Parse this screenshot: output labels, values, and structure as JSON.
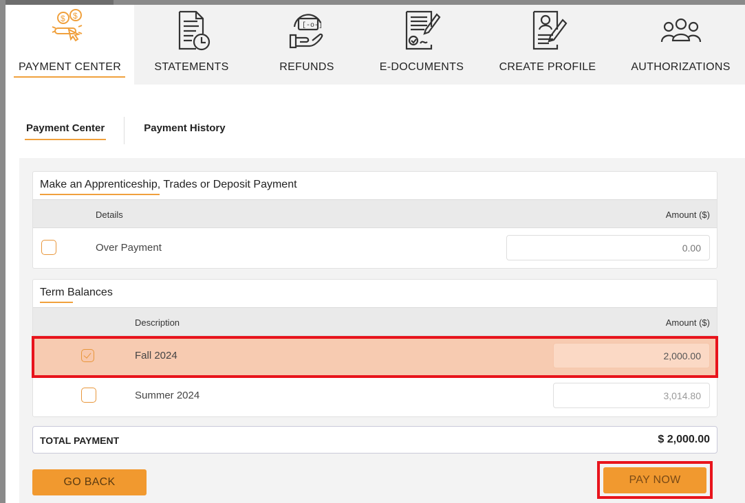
{
  "nav": {
    "items": [
      {
        "label": "PAYMENT CENTER",
        "icon": "payment-hand-icon",
        "active": true
      },
      {
        "label": "STATEMENTS",
        "icon": "statement-clock-icon",
        "active": false
      },
      {
        "label": "REFUNDS",
        "icon": "refund-hand-icon",
        "active": false
      },
      {
        "label": "E-DOCUMENTS",
        "icon": "document-sign-icon",
        "active": false
      },
      {
        "label": "CREATE PROFILE",
        "icon": "profile-edit-icon",
        "active": false
      },
      {
        "label": "AUTHORIZATIONS",
        "icon": "group-users-icon",
        "active": false
      }
    ]
  },
  "subtabs": {
    "payment_center": "Payment Center",
    "payment_history": "Payment History"
  },
  "deposit": {
    "title": "Make an Apprenticeship, Trades or Deposit Payment",
    "col_details": "Details",
    "col_amount": "Amount ($)",
    "rows": [
      {
        "label": "Over Payment",
        "placeholder": "0.00",
        "checked": false
      }
    ]
  },
  "terms": {
    "title": "Term Balances",
    "col_description": "Description",
    "col_amount": "Amount ($)",
    "rows": [
      {
        "label": "Fall 2024",
        "amount": "2,000.00",
        "checked": true
      },
      {
        "label": "Summer 2024",
        "amount": "3,014.80",
        "checked": false
      }
    ]
  },
  "total": {
    "label": "TOTAL PAYMENT",
    "value": "$ 2,000.00"
  },
  "buttons": {
    "go_back": "GO BACK",
    "pay_now": "PAY NOW"
  },
  "colors": {
    "accent": "#f1992f",
    "selected_row": "#f7cbb1",
    "highlight": "#e8141c"
  }
}
